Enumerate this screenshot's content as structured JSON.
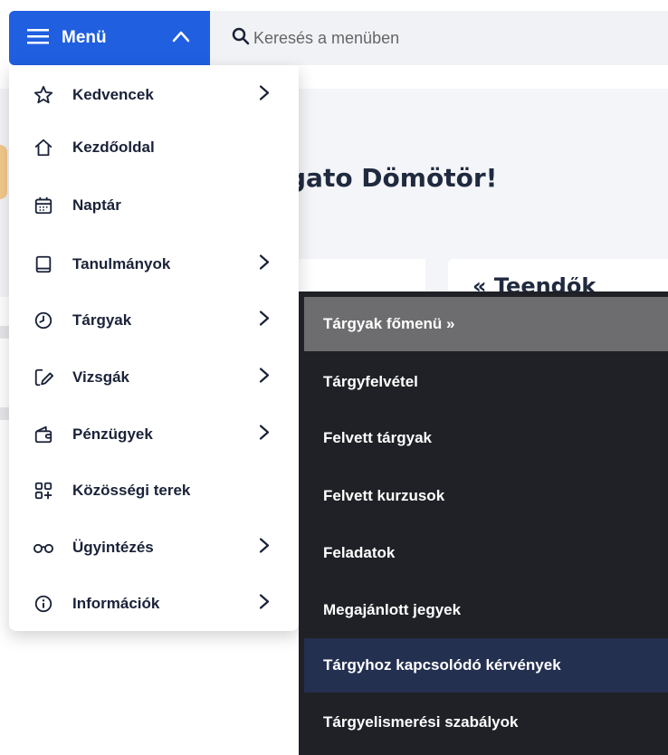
{
  "topbar": {
    "menu_label": "Menü",
    "search_placeholder": "Keresés a menüben"
  },
  "background": {
    "greeting": "gato Dömötör!",
    "todo_title": "« Teendők"
  },
  "menu": {
    "items": [
      {
        "label": "Kedvencek",
        "icon": "star-icon",
        "has_submenu": true
      },
      {
        "label": "Kezdőoldal",
        "icon": "home-icon",
        "has_submenu": false
      },
      {
        "label": "Naptár",
        "icon": "calendar-icon",
        "has_submenu": false
      },
      {
        "label": "Tanulmányok",
        "icon": "book-icon",
        "has_submenu": true
      },
      {
        "label": "Tárgyak",
        "icon": "clock-icon",
        "has_submenu": true
      },
      {
        "label": "Vizsgák",
        "icon": "exam-edit-icon",
        "has_submenu": true
      },
      {
        "label": "Pénzügyek",
        "icon": "wallet-icon",
        "has_submenu": true
      },
      {
        "label": "Közösségi terek",
        "icon": "grid-plus-icon",
        "has_submenu": false
      },
      {
        "label": "Ügyintézés",
        "icon": "glasses-icon",
        "has_submenu": true
      },
      {
        "label": "Információk",
        "icon": "info-icon",
        "has_submenu": true
      }
    ]
  },
  "submenu": {
    "items": [
      {
        "label": "Tárgyak főmenü »",
        "state": "header"
      },
      {
        "label": "Tárgyfelvétel",
        "state": "normal"
      },
      {
        "label": "Felvett tárgyak",
        "state": "normal"
      },
      {
        "label": "Felvett kurzusok",
        "state": "normal"
      },
      {
        "label": "Feladatok",
        "state": "normal"
      },
      {
        "label": "Megajánlott jegyek",
        "state": "normal"
      },
      {
        "label": "Tárgyhoz kapcsolódó kérvények",
        "state": "active"
      },
      {
        "label": "Tárgyelismerési szabályok",
        "state": "normal"
      }
    ]
  },
  "colors": {
    "primary": "#1f5fe0",
    "submenu_bg": "#1f2126",
    "submenu_header": "#6d6d6f",
    "submenu_active": "#243050",
    "text_dark": "#1a2238"
  }
}
